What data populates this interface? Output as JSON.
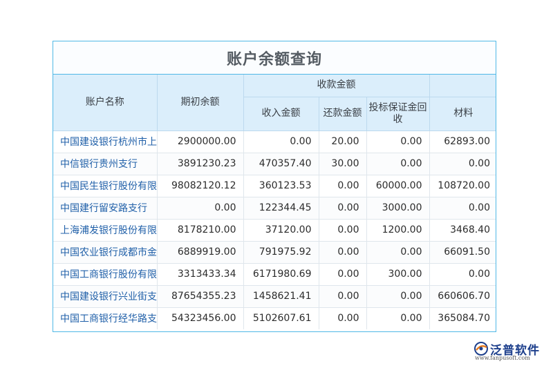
{
  "title": "账户余额查询",
  "columns": {
    "account_name": "账户名称",
    "opening_balance": "期初余额",
    "receipts_group": "收款金额",
    "income": "收入金额",
    "repayment": "还款金额",
    "bid_deposit": "投标保证金回收",
    "materials": "材料"
  },
  "rows": [
    {
      "name": "中国建设银行杭州市上",
      "opening": "2900000.00",
      "income": "0.00",
      "repay": "20.00",
      "deposit": "0.00",
      "material": "62893.00"
    },
    {
      "name": "中信银行贵州支行",
      "opening": "3891230.23",
      "income": "470357.40",
      "repay": "30.00",
      "deposit": "0.00",
      "material": "0.00"
    },
    {
      "name": "中国民生银行股份有限",
      "opening": "98082120.12",
      "income": "360123.53",
      "repay": "0.00",
      "deposit": "60000.00",
      "material": "108720.00"
    },
    {
      "name": "中国建行留安路支行",
      "opening": "0.00",
      "income": "122344.45",
      "repay": "0.00",
      "deposit": "3000.00",
      "material": "0.00"
    },
    {
      "name": "上海浦发银行股份有限",
      "opening": "8178210.00",
      "income": "37120.00",
      "repay": "0.00",
      "deposit": "1200.00",
      "material": "3468.40"
    },
    {
      "name": "中国农业银行成都市金",
      "opening": "6889919.00",
      "income": "791975.92",
      "repay": "0.00",
      "deposit": "0.00",
      "material": "66091.50"
    },
    {
      "name": "中国工商银行股份有限",
      "opening": "3313433.34",
      "income": "6171980.69",
      "repay": "0.00",
      "deposit": "300.00",
      "material": "0.00"
    },
    {
      "name": "中国建设银行兴业街支",
      "opening": "87654355.23",
      "income": "1458621.41",
      "repay": "0.00",
      "deposit": "0.00",
      "material": "660606.70"
    },
    {
      "name": "中国工商银行经华路支",
      "opening": "54323456.00",
      "income": "5102607.61",
      "repay": "0.00",
      "deposit": "0.00",
      "material": "365084.70"
    }
  ],
  "logo": {
    "brand": "泛普软件",
    "url": "www.fanpusoft.com",
    "icon": "fanpu-logo-icon",
    "color": "#1d3f8c"
  },
  "colors": {
    "border": "#4fb8e6",
    "header_bg": "#dbeefb",
    "link_text": "#1f5fa8"
  }
}
